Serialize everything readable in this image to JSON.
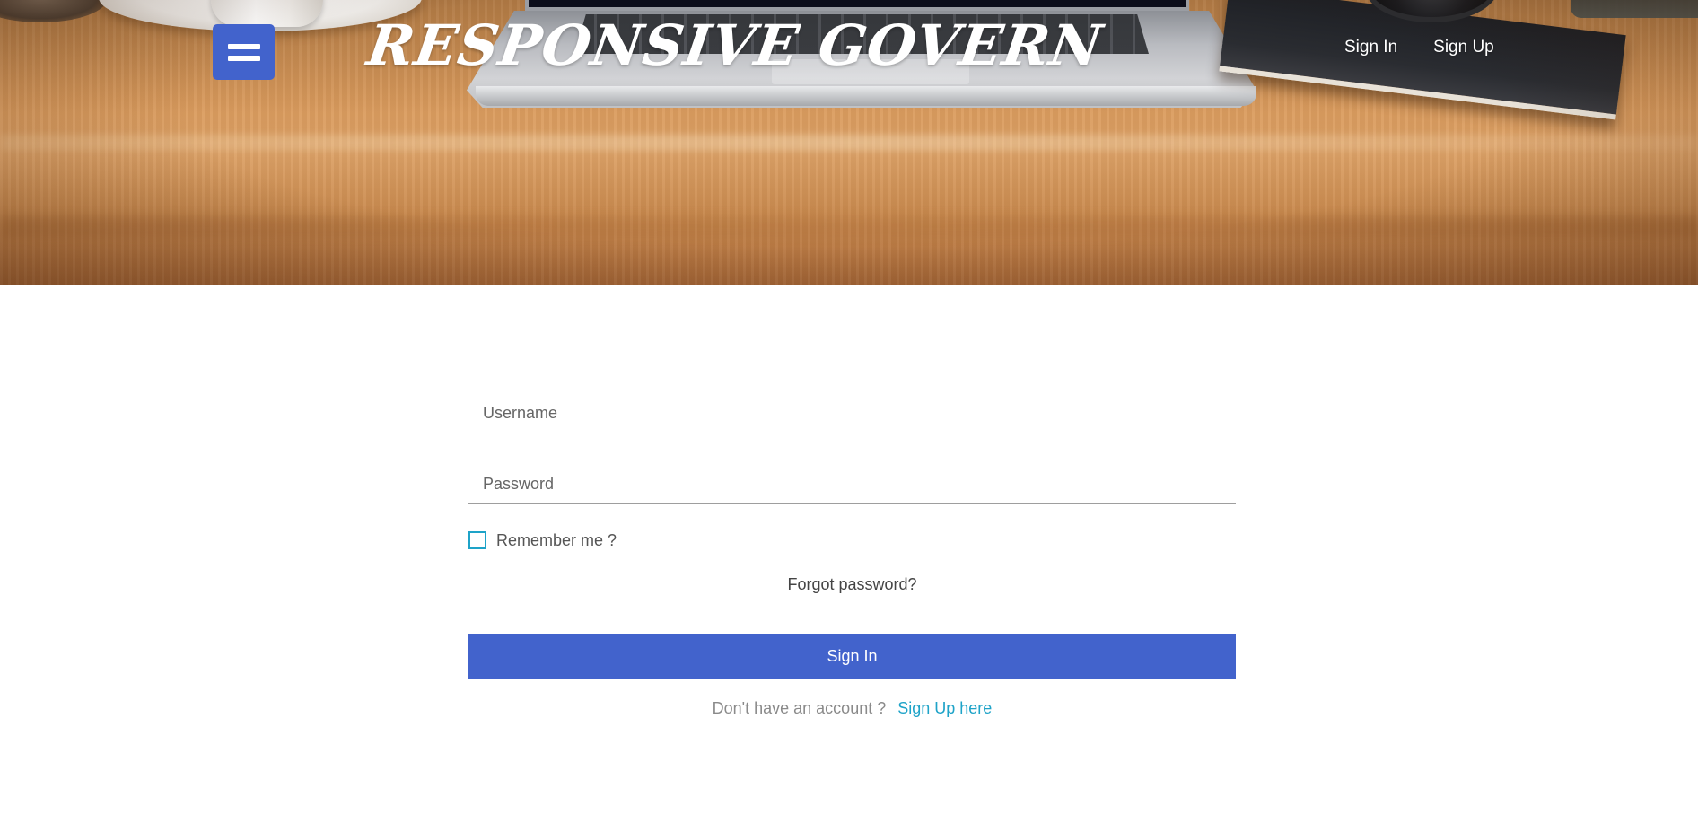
{
  "header": {
    "brand": "RESPONSIVE GOVERN",
    "nav": {
      "sign_in": "Sign In",
      "sign_up": "Sign Up"
    },
    "menu_icon": "hamburger-icon",
    "accent_color": "#4263cc"
  },
  "form": {
    "username": {
      "placeholder": "Username",
      "value": ""
    },
    "password": {
      "placeholder": "Password",
      "value": ""
    },
    "remember_label": "Remember me ?",
    "remember_checked": false,
    "forgot_password": "Forgot password?",
    "submit_label": "Sign In",
    "no_account_text": "Don't have an account ?",
    "signup_link": "Sign Up here",
    "link_color": "#1ea3c8"
  }
}
